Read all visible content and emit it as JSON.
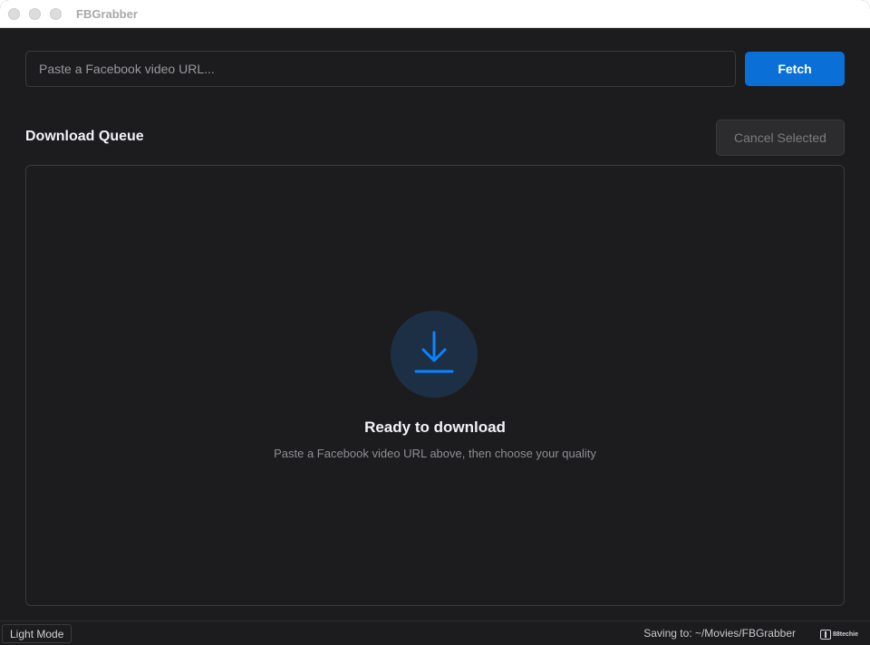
{
  "window": {
    "title": "FBGrabber"
  },
  "url_bar": {
    "placeholder": "Paste a Facebook video URL...",
    "value": "",
    "fetch_label": "Fetch"
  },
  "queue": {
    "title": "Download Queue",
    "cancel_label": "Cancel Selected",
    "empty_icon": "download-icon",
    "empty_title": "Ready to download",
    "empty_subtitle": "Paste a Facebook video URL above, then choose your quality"
  },
  "status_bar": {
    "mode_label": "Light Mode",
    "saving_text": "Saving to: ~/Movies/FBGrabber",
    "brand_text": "88techie"
  },
  "colors": {
    "accent": "#0a6fd6",
    "background": "#1c1c1e",
    "icon_circle": "#1d2f44"
  }
}
